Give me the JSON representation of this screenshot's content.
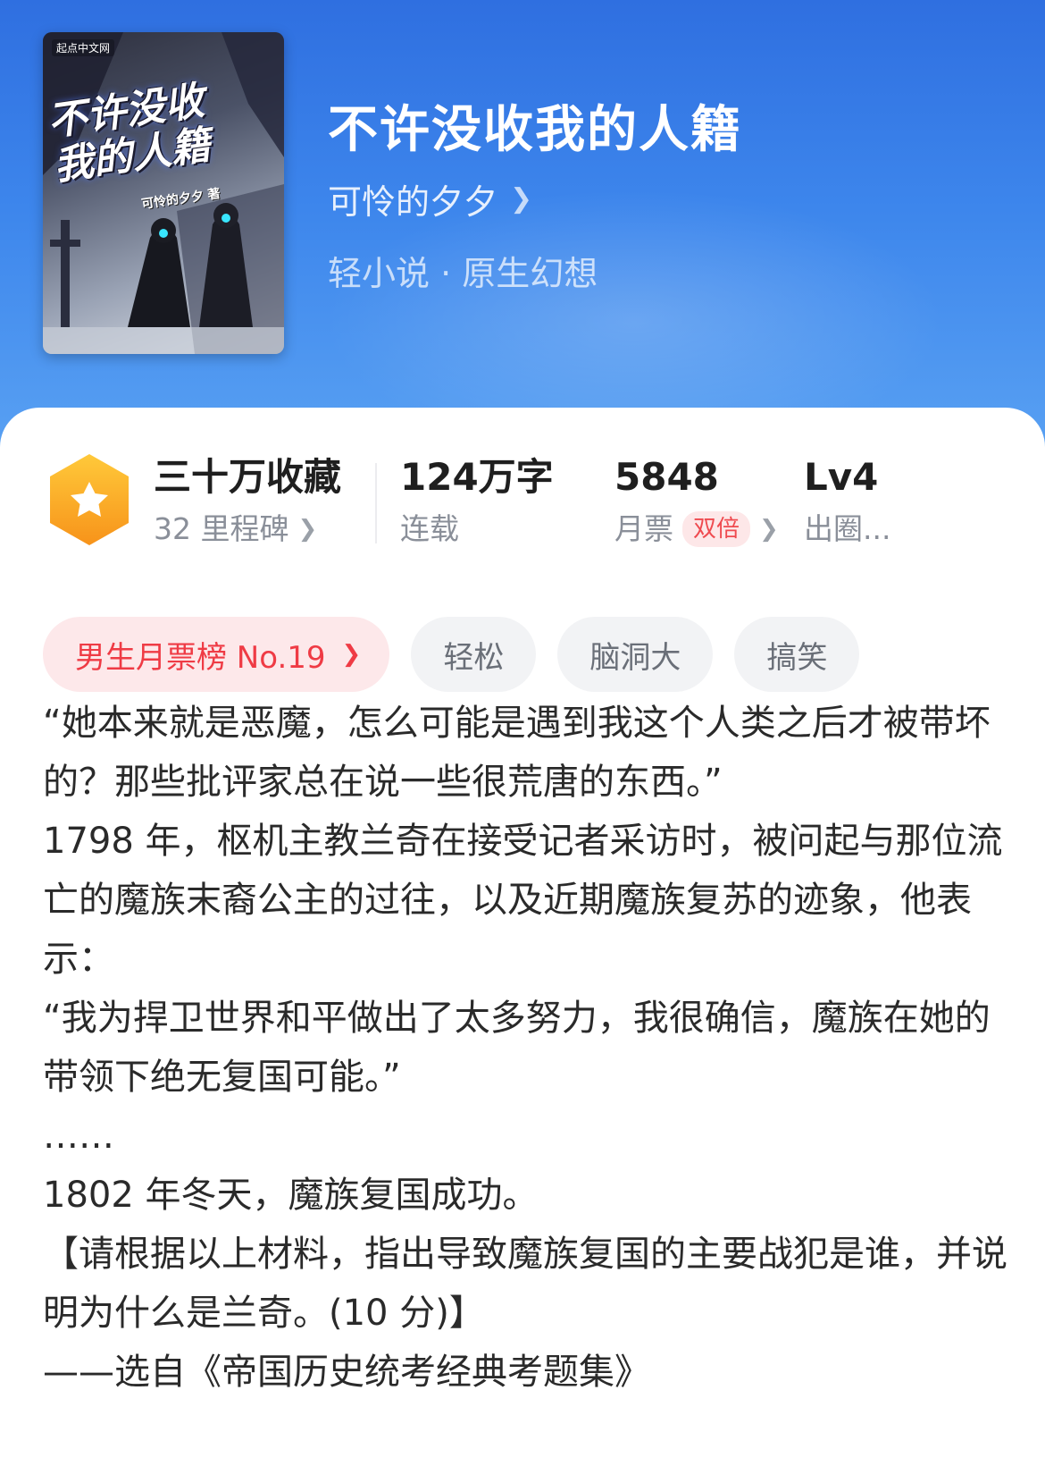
{
  "book": {
    "title": "不许没收我的人籍",
    "author": "可怜的夕夕",
    "category": "轻小说 · 原生幻想",
    "cover": {
      "publisher": "起点中文网",
      "title_line1": "不许没收",
      "title_line2": "我的人籍",
      "author_line": "可怜的夕夕 著"
    }
  },
  "stats": {
    "favorites": {
      "value": "三十万收藏",
      "label": "32 里程碑"
    },
    "words": {
      "value": "124万字",
      "label": "连载"
    },
    "tickets": {
      "value": "5848",
      "label": "月票",
      "tag": "双倍"
    },
    "level": {
      "value": "Lv4",
      "label": "出圈..."
    }
  },
  "tags": {
    "rank": "男生月票榜 No.19",
    "items": [
      "轻松",
      "脑洞大",
      "搞笑"
    ]
  },
  "description": [
    "“她本来就是恶魔，怎么可能是遇到我这个人类之后才被带坏的？那些批评家总在说一些很荒唐的东西。”",
    "1798 年，枢机主教兰奇在接受记者采访时，被问起与那位流亡的魔族末裔公主的过往，以及近期魔族复苏的迹象，他表示：",
    "“我为捍卫世界和平做出了太多努力，我很确信，魔族在她的带领下绝无复国可能。”",
    "……",
    "1802 年冬天，魔族复国成功。",
    "【请根据以上材料，指出导致魔族复国的主要战犯是谁，并说明为什么是兰奇。(10 分)】",
    "——选自《帝国历史统考经典考题集》"
  ],
  "colors": {
    "hero_top": "#2f6fe0",
    "hero_bottom": "#5aa2f3",
    "accent_red": "#ef3b45",
    "badge_orange": "#f7a21b"
  },
  "icons": {
    "milestone_badge": "star-hexagon-icon",
    "chevron": "chevron-right-icon"
  }
}
